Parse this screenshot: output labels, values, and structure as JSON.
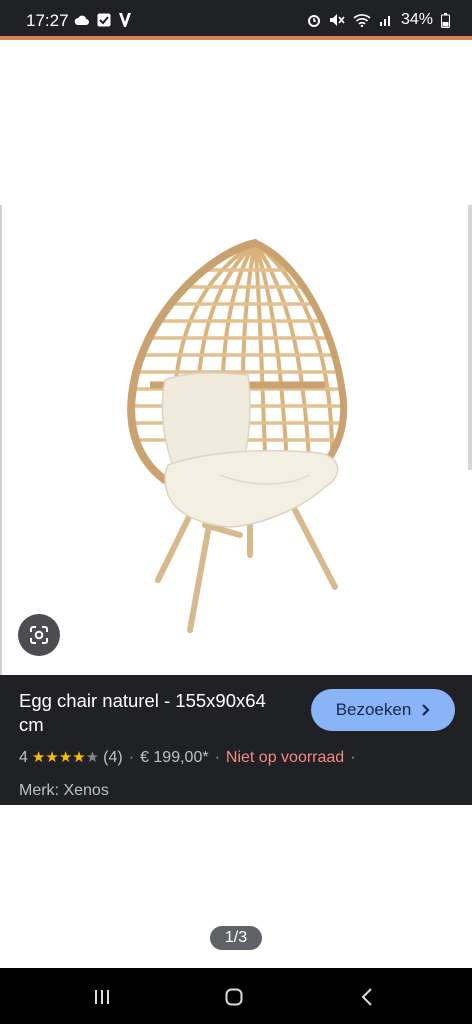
{
  "status": {
    "time": "17:27",
    "battery": "34%",
    "icons": [
      "cloud-icon",
      "check-box-icon",
      "v-app-icon",
      "alarm-icon",
      "mute-icon",
      "wifi-icon",
      "signal-icon",
      "battery-icon"
    ]
  },
  "result": {
    "title": "Egg chair naturel - 155x90x64 cm",
    "visit_label": "Bezoeken",
    "rating_value": "4",
    "rating_stars_filled": 4,
    "rating_stars_total": 5,
    "review_count": "(4)",
    "price": "€ 199,00*",
    "stock": "Niet op voorraad",
    "brand": "Merk: Xenos"
  },
  "pager": {
    "label": "1/3"
  },
  "colors": {
    "accent_button": "#8ab4f8",
    "panel": "#202124",
    "stock_warning": "#f28b82",
    "star": "#fbbc04"
  }
}
